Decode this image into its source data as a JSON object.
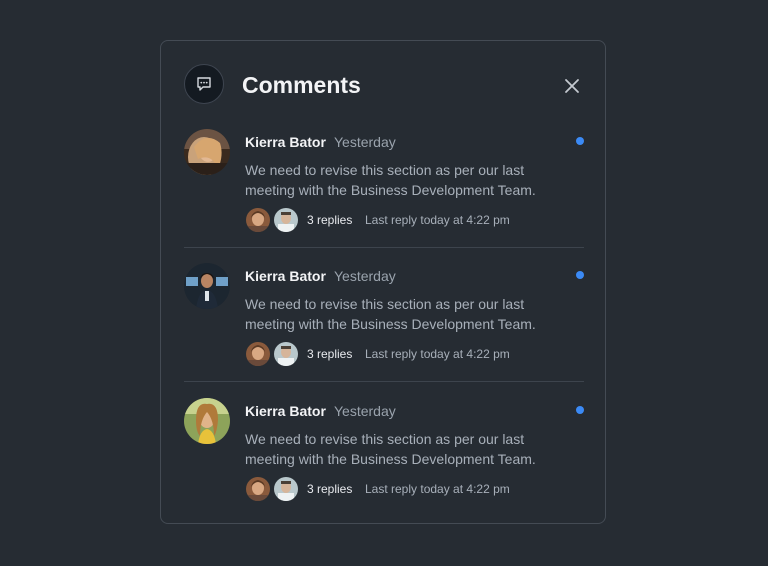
{
  "header": {
    "title": "Comments",
    "icon": "comment-icon",
    "close_icon": "close-icon"
  },
  "comments": [
    {
      "author": "Kierra Bator",
      "time": "Yesterday",
      "text": "We need to revise this section as per our last meeting with the Business Development Team.",
      "replies_label": "3 replies",
      "last_reply": "Last reply today at 4:22 pm",
      "unread": true
    },
    {
      "author": "Kierra Bator",
      "time": "Yesterday",
      "text": "We need to revise this section as per our last meeting with the Business Development Team.",
      "replies_label": "3 replies",
      "last_reply": "Last reply today at 4:22 pm",
      "unread": true
    },
    {
      "author": "Kierra Bator",
      "time": "Yesterday",
      "text": "We need to revise this section as per our last meeting with the Business Development Team.",
      "replies_label": "3 replies",
      "last_reply": "Last reply today at 4:22 pm",
      "unread": true
    }
  ],
  "colors": {
    "background": "#262c33",
    "accent_dot": "#3b8af5",
    "border": "#444b54"
  }
}
